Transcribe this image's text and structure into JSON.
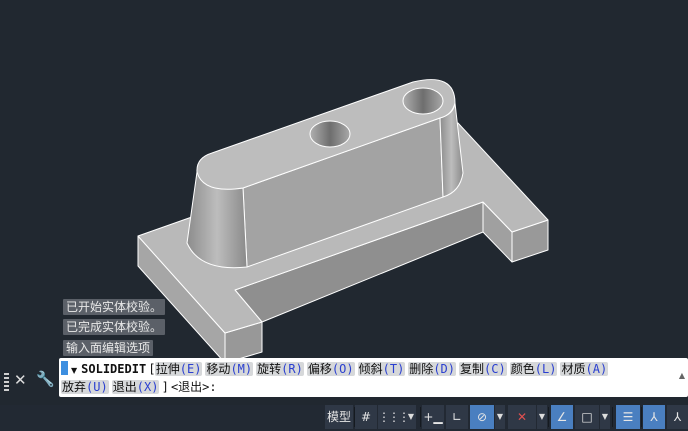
{
  "messages": [
    "已开始实体校验。",
    "已完成实体校验。",
    "输入面编辑选项"
  ],
  "command": {
    "name": "SOLIDEDIT",
    "options": [
      {
        "label": "拉伸",
        "key": "E"
      },
      {
        "label": "移动",
        "key": "M"
      },
      {
        "label": "旋转",
        "key": "R"
      },
      {
        "label": "偏移",
        "key": "O"
      },
      {
        "label": "倾斜",
        "key": "T"
      },
      {
        "label": "删除",
        "key": "D"
      },
      {
        "label": "复制",
        "key": "C"
      },
      {
        "label": "颜色",
        "key": "L"
      },
      {
        "label": "材质",
        "key": "A"
      },
      {
        "label": "放弃",
        "key": "U"
      },
      {
        "label": "退出",
        "key": "X"
      }
    ],
    "default_prompt": "<退出>:"
  },
  "statusbar": {
    "model_label": "模型",
    "active_color": "#4a7fc0"
  },
  "colors": {
    "background": "#212830",
    "model_top": "#bdbdbd",
    "edge": "#ffffff"
  }
}
